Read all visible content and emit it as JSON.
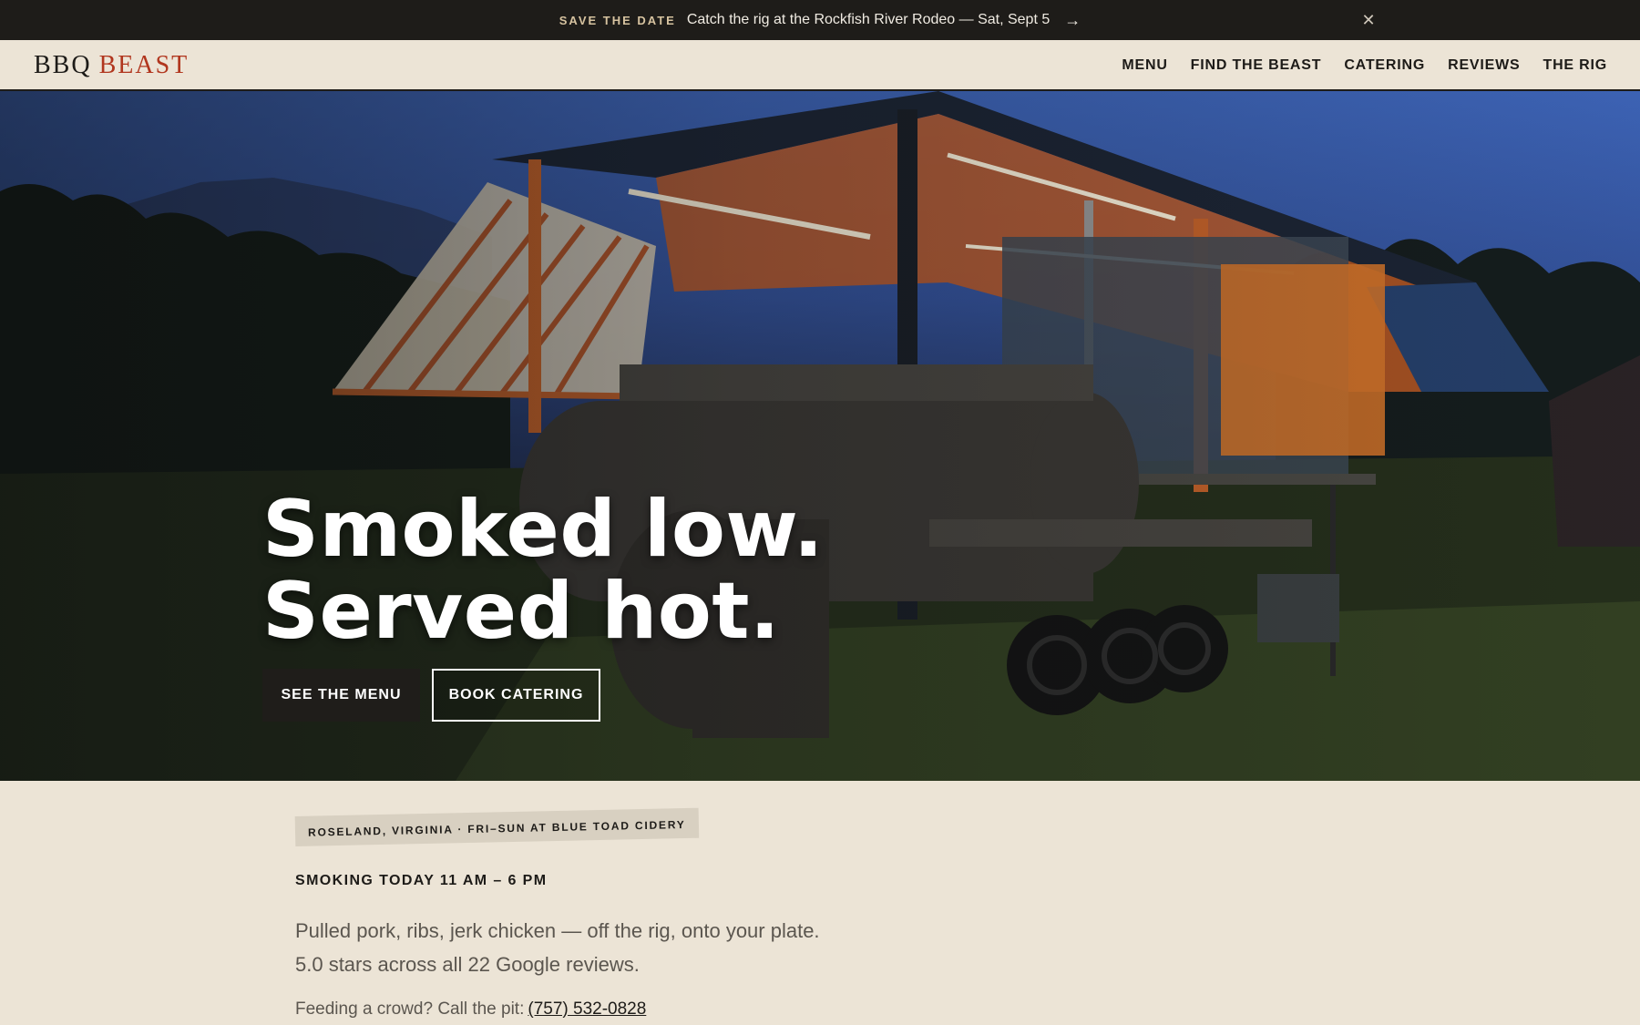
{
  "announcement": {
    "tag": "SAVE THE DATE",
    "message": "Catch the rig at the Rockfish River Rodeo — Sat, Sept 5",
    "arrow_icon": "arrow-right-icon",
    "close_icon": "close-icon"
  },
  "header": {
    "logo_word1": "BBQ",
    "logo_word2": "BEAST",
    "nav": [
      "MENU",
      "FIND THE BEAST",
      "CATERING",
      "REVIEWS",
      "THE RIG"
    ]
  },
  "hero": {
    "headline_line1": "Smoked low.",
    "headline_line2": "Served hot.",
    "primary_button": "SEE THE MENU",
    "secondary_button": "BOOK CATERING"
  },
  "info": {
    "location_tag": "ROSELAND, VIRGINIA · FRI–SUN AT BLUE TOAD CIDERY",
    "hours": "SMOKING TODAY 11 AM – 6 PM",
    "blurb_line1": "Pulled pork, ribs, jerk chicken — off the rig, onto your plate.",
    "blurb_line2": "5.0 stars across all 22 Google reviews.",
    "crowd_text": "Feeding a crowd? Call the pit:",
    "phone": "(757) 532-0828"
  },
  "colors": {
    "background": "#ece4d6",
    "dark": "#1e1c19",
    "brand_red": "#b1361e",
    "rig_orange": "#e07a2a"
  }
}
